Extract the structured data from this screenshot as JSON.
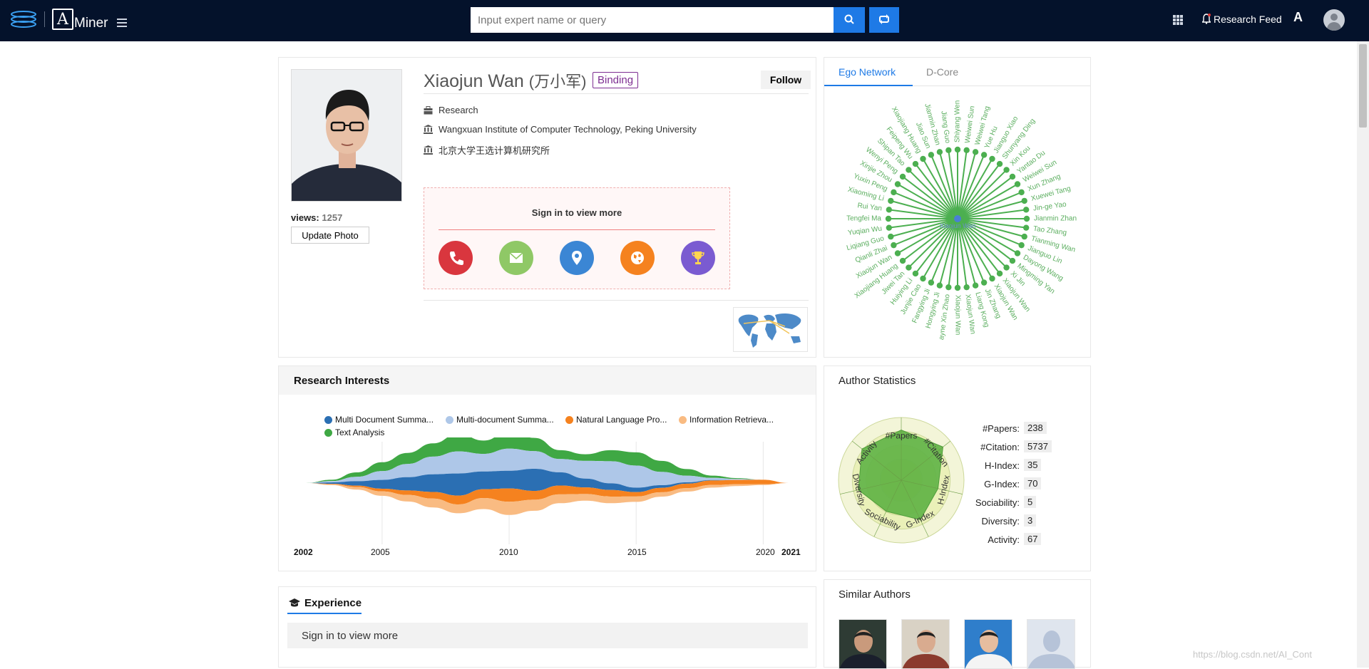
{
  "topbar": {
    "logo_text": "Miner",
    "logo_letter": "A",
    "search_placeholder": "Input expert name or query",
    "research_feed": "Research Feed",
    "lang_label": "A"
  },
  "profile": {
    "name": "Xiaojun Wan",
    "name_cn": "(万小军)",
    "binding": "Binding",
    "follow": "Follow",
    "views_label": "views:",
    "views_value": "1257",
    "update_photo": "Update Photo",
    "position": "Research",
    "affiliation": "Wangxuan Institute of Computer Technology, Peking University",
    "affiliation_cn": "北京大学王选计算机研究所",
    "signin_text": "Sign in to view more",
    "contact_icons": [
      {
        "name": "phone-icon",
        "color": "#d9363e"
      },
      {
        "name": "email-icon",
        "color": "#8fc866"
      },
      {
        "name": "location-icon",
        "color": "#3b86d4"
      },
      {
        "name": "homepage-icon",
        "color": "#f5821f"
      },
      {
        "name": "award-icon",
        "color": "#7a5bd1"
      }
    ]
  },
  "ego": {
    "tabs": [
      "Ego Network",
      "D-Core"
    ],
    "center_color": "#4a7fd4",
    "node_color": "#4caf50",
    "center_label": "Xiaojun Wan",
    "nodes": [
      "Shiyang Wen",
      "Weiwei Sun",
      "Weiwei Tang",
      "Yue Hu",
      "Jianguo Xiao",
      "Shunyang Ding",
      "Xin Kou",
      "Yantao Du",
      "Weiwei Sun",
      "Xun Zhang",
      "Xuewei Tang",
      "Jin-ge Yao",
      "Jianmin Zhan",
      "Tao Zhang",
      "Tianming Wan",
      "Jianguo Lin",
      "Dayong Wang",
      "Mingming Yan",
      "Xi Jin",
      "Xiaojun Wan",
      "Xiaojun Wan",
      "Jin Zhang",
      "Liang Kong",
      "Xiaojun Wan",
      "Xiaojun Wan",
      "ayne Xin Zhao",
      "Hongying Ji",
      "Fangying Ji",
      "Junjie Cao",
      "Huiying Li",
      "Jiwei Tan",
      "Xiaojiang Huang",
      "Xiaojun Wan",
      "Qianli Zhai",
      "Liqiang Guo",
      "Yuqian Wu",
      "Tengfei Ma",
      "Rui Yan",
      "Xiaoming Li",
      "Yuxin Peng",
      "Xinjie Zhou",
      "Wenyi Peng",
      "Shipan Tao",
      "Feipeng Wu",
      "Xiaojiang Huang",
      "Jiao Sun",
      "Jianmin Zhan",
      "Jiang Guo"
    ]
  },
  "research": {
    "title": "Research Interests",
    "years": [
      "2002",
      "2005",
      "2010",
      "2015",
      "2020",
      "2021"
    ]
  },
  "chart_data": {
    "type": "area",
    "title": "",
    "x": [
      2002,
      2003,
      2004,
      2005,
      2006,
      2007,
      2008,
      2009,
      2010,
      2011,
      2012,
      2013,
      2014,
      2015,
      2016,
      2017,
      2018,
      2019,
      2020,
      2021
    ],
    "xlim": [
      2002,
      2021
    ],
    "series": [
      {
        "name": "Multi Document Summa...",
        "color": "#2b6fb3",
        "values": [
          0,
          0.3,
          1,
          2,
          3,
          4,
          5,
          4,
          4,
          5,
          3,
          2,
          1.5,
          1,
          0.6,
          0.3,
          0.1,
          0,
          0,
          0
        ]
      },
      {
        "name": "Multi-document Summa...",
        "color": "#aec7e8",
        "values": [
          0,
          0.3,
          1,
          2,
          3,
          4,
          5,
          4,
          5,
          4,
          3,
          4,
          5,
          5,
          3,
          1.5,
          0.5,
          0.2,
          0,
          0
        ]
      },
      {
        "name": "Natural Language Pro...",
        "color": "#f5821f",
        "values": [
          0,
          0.1,
          0.3,
          0.6,
          1,
          1.5,
          2,
          2,
          3,
          2,
          2,
          1.5,
          1.5,
          1,
          1,
          1,
          1,
          1,
          1,
          0
        ]
      },
      {
        "name": "Information Retrieva...",
        "color": "#f9bb82",
        "values": [
          0,
          0.2,
          0.6,
          1,
          1.5,
          2,
          2,
          2.5,
          3,
          2.5,
          2,
          1.5,
          1.5,
          1.2,
          1,
          0.8,
          0.6,
          0.4,
          0.2,
          0
        ]
      },
      {
        "name": "Text Analysis",
        "color": "#3fa844",
        "values": [
          0,
          0.3,
          1,
          2,
          2.5,
          3,
          4,
          3,
          4,
          3,
          2,
          1.5,
          2.5,
          3,
          2.5,
          1.5,
          0.5,
          0.2,
          0,
          0
        ]
      }
    ]
  },
  "stats": {
    "title": "Author Statistics",
    "items": [
      {
        "label": "#Papers:",
        "value": "238"
      },
      {
        "label": "#Citation:",
        "value": "5737"
      },
      {
        "label": "H-Index:",
        "value": "35"
      },
      {
        "label": "G-Index:",
        "value": "70"
      },
      {
        "label": "Sociability:",
        "value": "5"
      },
      {
        "label": "Diversity:",
        "value": "3"
      },
      {
        "label": "Activity:",
        "value": "67"
      }
    ],
    "radar_axes": [
      "#Papers",
      "#Citation",
      "H-Index",
      "G-Index",
      "Sociability",
      "Diversity",
      "Activity"
    ],
    "radar_levels": [
      0.8,
      0.85,
      0.6,
      0.7,
      0.55,
      0.7,
      0.8
    ]
  },
  "experience": {
    "title": "Experience",
    "signin_text": "Sign in to view more"
  },
  "similar": {
    "title": "Similar Authors"
  },
  "watermark": "https://blog.csdn.net/AI_Cont"
}
